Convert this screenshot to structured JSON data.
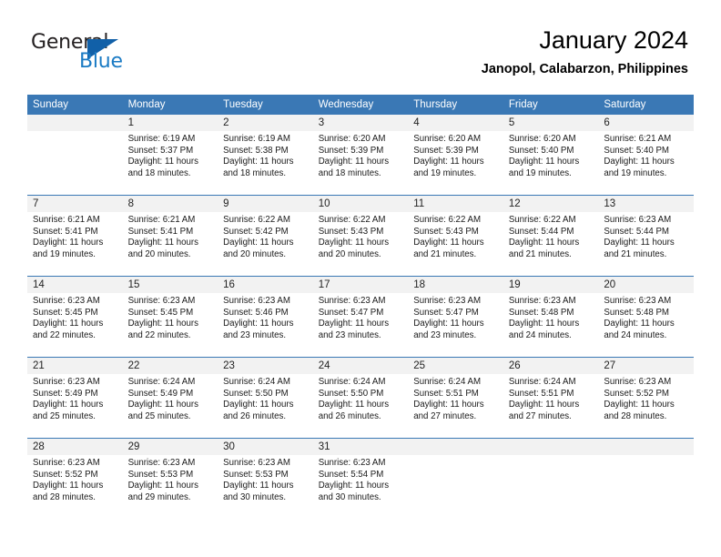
{
  "brand": {
    "name_top": "General",
    "name_bottom": "Blue",
    "accent_color": "#1b7bc4",
    "triangle_color": "#1160a8"
  },
  "header": {
    "title": "January 2024",
    "subtitle": "Janopol, Calabarzon, Philippines"
  },
  "calendar": {
    "header_bg": "#3a78b5",
    "daynum_bg": "#f2f2f2",
    "weekday_labels": [
      "Sunday",
      "Monday",
      "Tuesday",
      "Wednesday",
      "Thursday",
      "Friday",
      "Saturday"
    ],
    "weeks": [
      [
        {
          "day": "",
          "lines": []
        },
        {
          "day": "1",
          "lines": [
            "Sunrise: 6:19 AM",
            "Sunset: 5:37 PM",
            "Daylight: 11 hours",
            "and 18 minutes."
          ]
        },
        {
          "day": "2",
          "lines": [
            "Sunrise: 6:19 AM",
            "Sunset: 5:38 PM",
            "Daylight: 11 hours",
            "and 18 minutes."
          ]
        },
        {
          "day": "3",
          "lines": [
            "Sunrise: 6:20 AM",
            "Sunset: 5:39 PM",
            "Daylight: 11 hours",
            "and 18 minutes."
          ]
        },
        {
          "day": "4",
          "lines": [
            "Sunrise: 6:20 AM",
            "Sunset: 5:39 PM",
            "Daylight: 11 hours",
            "and 19 minutes."
          ]
        },
        {
          "day": "5",
          "lines": [
            "Sunrise: 6:20 AM",
            "Sunset: 5:40 PM",
            "Daylight: 11 hours",
            "and 19 minutes."
          ]
        },
        {
          "day": "6",
          "lines": [
            "Sunrise: 6:21 AM",
            "Sunset: 5:40 PM",
            "Daylight: 11 hours",
            "and 19 minutes."
          ]
        }
      ],
      [
        {
          "day": "7",
          "lines": [
            "Sunrise: 6:21 AM",
            "Sunset: 5:41 PM",
            "Daylight: 11 hours",
            "and 19 minutes."
          ]
        },
        {
          "day": "8",
          "lines": [
            "Sunrise: 6:21 AM",
            "Sunset: 5:41 PM",
            "Daylight: 11 hours",
            "and 20 minutes."
          ]
        },
        {
          "day": "9",
          "lines": [
            "Sunrise: 6:22 AM",
            "Sunset: 5:42 PM",
            "Daylight: 11 hours",
            "and 20 minutes."
          ]
        },
        {
          "day": "10",
          "lines": [
            "Sunrise: 6:22 AM",
            "Sunset: 5:43 PM",
            "Daylight: 11 hours",
            "and 20 minutes."
          ]
        },
        {
          "day": "11",
          "lines": [
            "Sunrise: 6:22 AM",
            "Sunset: 5:43 PM",
            "Daylight: 11 hours",
            "and 21 minutes."
          ]
        },
        {
          "day": "12",
          "lines": [
            "Sunrise: 6:22 AM",
            "Sunset: 5:44 PM",
            "Daylight: 11 hours",
            "and 21 minutes."
          ]
        },
        {
          "day": "13",
          "lines": [
            "Sunrise: 6:23 AM",
            "Sunset: 5:44 PM",
            "Daylight: 11 hours",
            "and 21 minutes."
          ]
        }
      ],
      [
        {
          "day": "14",
          "lines": [
            "Sunrise: 6:23 AM",
            "Sunset: 5:45 PM",
            "Daylight: 11 hours",
            "and 22 minutes."
          ]
        },
        {
          "day": "15",
          "lines": [
            "Sunrise: 6:23 AM",
            "Sunset: 5:45 PM",
            "Daylight: 11 hours",
            "and 22 minutes."
          ]
        },
        {
          "day": "16",
          "lines": [
            "Sunrise: 6:23 AM",
            "Sunset: 5:46 PM",
            "Daylight: 11 hours",
            "and 23 minutes."
          ]
        },
        {
          "day": "17",
          "lines": [
            "Sunrise: 6:23 AM",
            "Sunset: 5:47 PM",
            "Daylight: 11 hours",
            "and 23 minutes."
          ]
        },
        {
          "day": "18",
          "lines": [
            "Sunrise: 6:23 AM",
            "Sunset: 5:47 PM",
            "Daylight: 11 hours",
            "and 23 minutes."
          ]
        },
        {
          "day": "19",
          "lines": [
            "Sunrise: 6:23 AM",
            "Sunset: 5:48 PM",
            "Daylight: 11 hours",
            "and 24 minutes."
          ]
        },
        {
          "day": "20",
          "lines": [
            "Sunrise: 6:23 AM",
            "Sunset: 5:48 PM",
            "Daylight: 11 hours",
            "and 24 minutes."
          ]
        }
      ],
      [
        {
          "day": "21",
          "lines": [
            "Sunrise: 6:23 AM",
            "Sunset: 5:49 PM",
            "Daylight: 11 hours",
            "and 25 minutes."
          ]
        },
        {
          "day": "22",
          "lines": [
            "Sunrise: 6:24 AM",
            "Sunset: 5:49 PM",
            "Daylight: 11 hours",
            "and 25 minutes."
          ]
        },
        {
          "day": "23",
          "lines": [
            "Sunrise: 6:24 AM",
            "Sunset: 5:50 PM",
            "Daylight: 11 hours",
            "and 26 minutes."
          ]
        },
        {
          "day": "24",
          "lines": [
            "Sunrise: 6:24 AM",
            "Sunset: 5:50 PM",
            "Daylight: 11 hours",
            "and 26 minutes."
          ]
        },
        {
          "day": "25",
          "lines": [
            "Sunrise: 6:24 AM",
            "Sunset: 5:51 PM",
            "Daylight: 11 hours",
            "and 27 minutes."
          ]
        },
        {
          "day": "26",
          "lines": [
            "Sunrise: 6:24 AM",
            "Sunset: 5:51 PM",
            "Daylight: 11 hours",
            "and 27 minutes."
          ]
        },
        {
          "day": "27",
          "lines": [
            "Sunrise: 6:23 AM",
            "Sunset: 5:52 PM",
            "Daylight: 11 hours",
            "and 28 minutes."
          ]
        }
      ],
      [
        {
          "day": "28",
          "lines": [
            "Sunrise: 6:23 AM",
            "Sunset: 5:52 PM",
            "Daylight: 11 hours",
            "and 28 minutes."
          ]
        },
        {
          "day": "29",
          "lines": [
            "Sunrise: 6:23 AM",
            "Sunset: 5:53 PM",
            "Daylight: 11 hours",
            "and 29 minutes."
          ]
        },
        {
          "day": "30",
          "lines": [
            "Sunrise: 6:23 AM",
            "Sunset: 5:53 PM",
            "Daylight: 11 hours",
            "and 30 minutes."
          ]
        },
        {
          "day": "31",
          "lines": [
            "Sunrise: 6:23 AM",
            "Sunset: 5:54 PM",
            "Daylight: 11 hours",
            "and 30 minutes."
          ]
        },
        {
          "day": "",
          "lines": []
        },
        {
          "day": "",
          "lines": []
        },
        {
          "day": "",
          "lines": []
        }
      ]
    ]
  }
}
